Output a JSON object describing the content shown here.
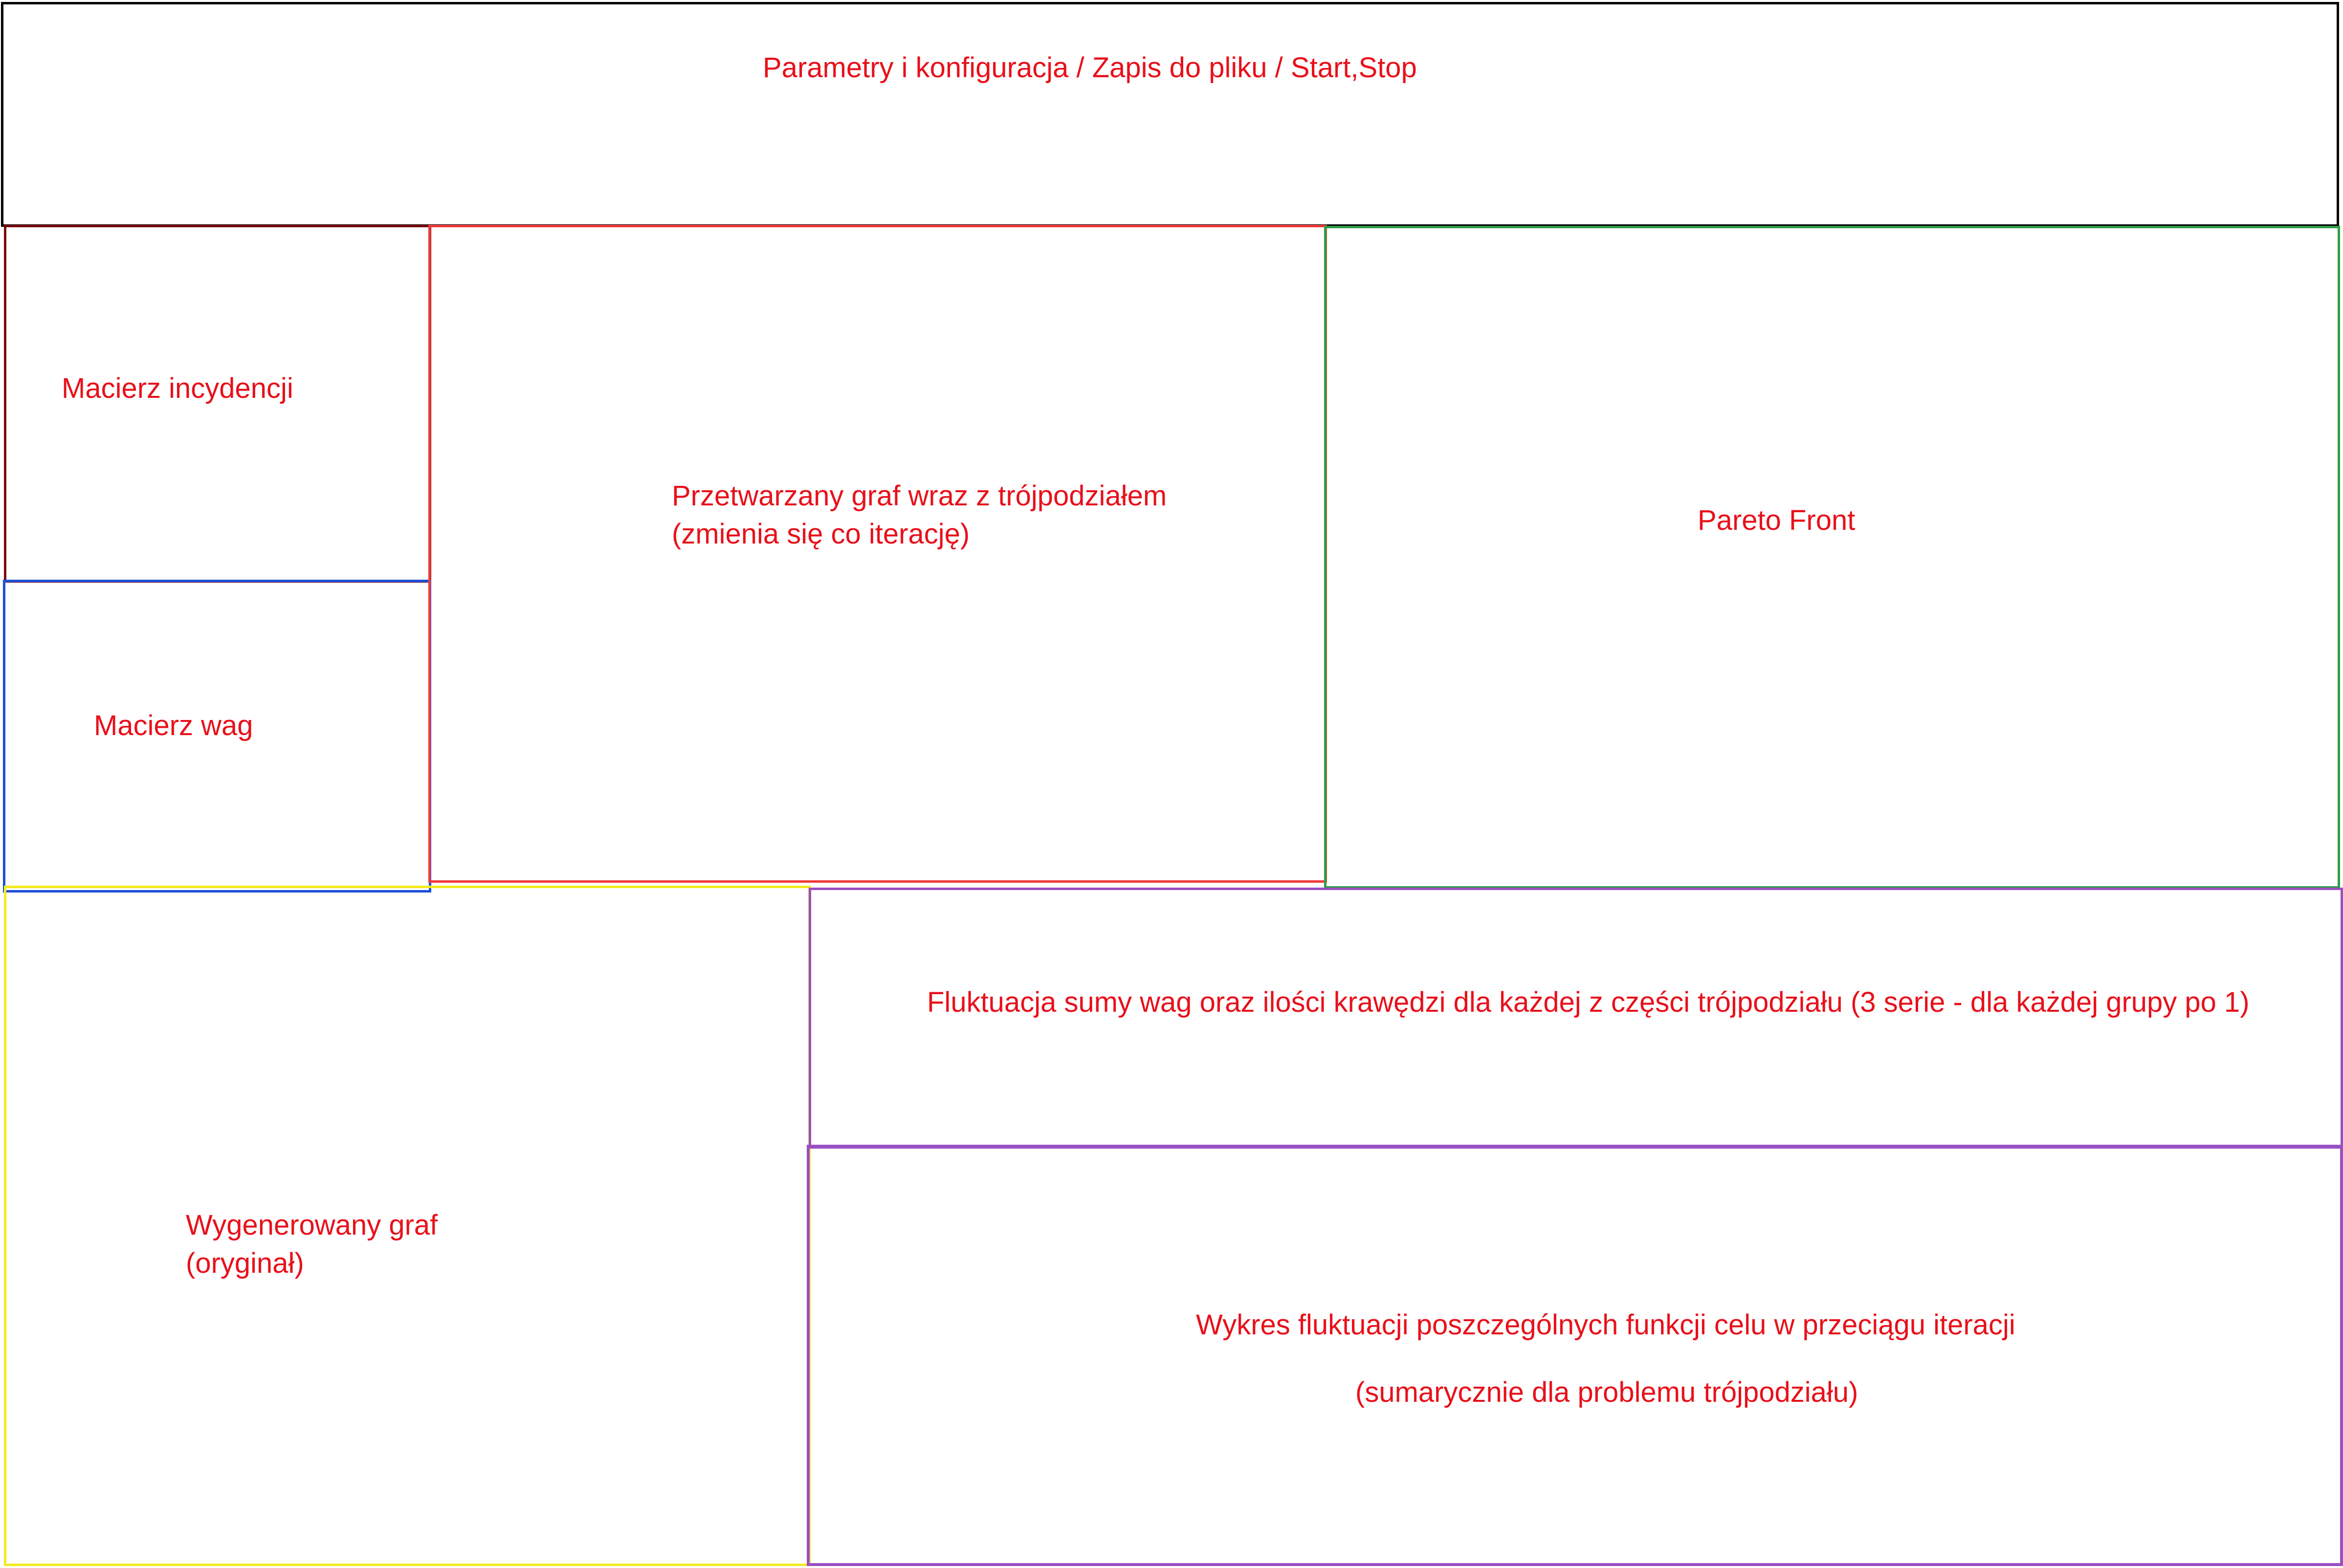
{
  "panels": {
    "top": {
      "label": "Parametry i konfiguracja / Zapis do pliku / Start,Stop"
    },
    "incidence_matrix": {
      "label": "Macierz incydencji"
    },
    "weight_matrix": {
      "label": "Macierz wag"
    },
    "processed_graph": {
      "line1": "Przetwarzany graf wraz z trójpodziałem",
      "line2": "(zmienia się co iterację)"
    },
    "pareto": {
      "label": "Pareto Front"
    },
    "original_graph": {
      "line1": "Wygenerowany graf",
      "line2": "(oryginał)"
    },
    "fluctuation": {
      "label": "Fluktuacja sumy wag oraz ilości krawędzi dla każdej z części trójpodziału (3 serie - dla każdej grupy po 1)"
    },
    "objective_chart": {
      "line1": "Wykres fluktuacji poszczególnych funkcji celu w przeciągu iteracji",
      "line2": "(sumarycznie dla problemu trójpodziału)"
    }
  },
  "colors": {
    "label_text": "#e8101a",
    "top_border": "#000000",
    "incidence_border": "#7a0a10",
    "weights_border": "#1d4fd8",
    "processed_border": "#ef3b3b",
    "pareto_border": "#2f9e44",
    "original_border": "#f4ea1e",
    "fluctuation_border": "#9a4fc2",
    "objective_border": "#9a4fc2"
  }
}
